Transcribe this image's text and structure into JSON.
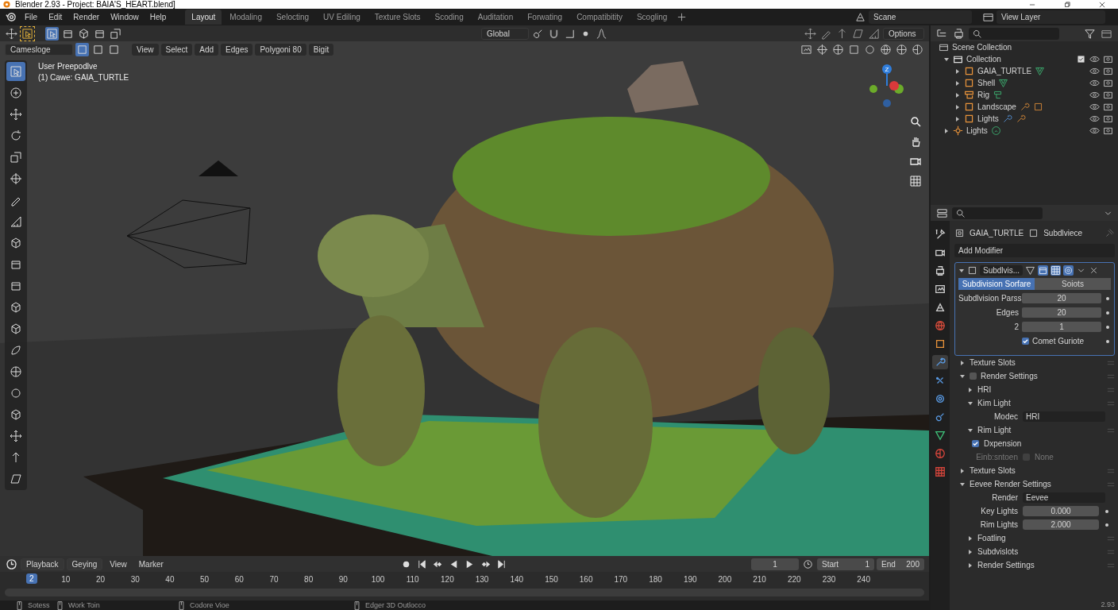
{
  "window": {
    "title": "Blender 2.93 - Project: BAIA'S_HEART.blend]"
  },
  "menu": [
    "File",
    "Edit",
    "Render",
    "Window",
    "Help"
  ],
  "workspaces": [
    {
      "label": "Layout",
      "selected": true
    },
    {
      "label": "Modaling",
      "selected": false
    },
    {
      "label": "Selocting",
      "selected": false
    },
    {
      "label": "UV Ediling",
      "selected": false
    },
    {
      "label": "Texture Slots",
      "selected": false
    },
    {
      "label": "Scoding",
      "selected": false
    },
    {
      "label": "Auditation",
      "selected": false
    },
    {
      "label": "Forwating",
      "selected": false
    },
    {
      "label": "Compatibitity",
      "selected": false
    },
    {
      "label": "Scogling",
      "selected": false
    }
  ],
  "scene": "Scane",
  "view_layer": "View Layer",
  "viewport": {
    "transform_orientation": "Global",
    "options": "Options",
    "mode": "Camesloge",
    "select_modes": [
      {
        "selected": true
      },
      {
        "selected": false
      },
      {
        "selected": false
      }
    ],
    "header_menus": [
      "View",
      "Select",
      "Add",
      "Edges",
      "Polygoni 80",
      "Bigit"
    ],
    "overlay_text": [
      "User Preepodlve",
      "(1) Cawe: GAIA_TURTLE"
    ],
    "gizmo_label": "Z",
    "tools": [
      {
        "kind": "select",
        "selected": true
      },
      {
        "kind": "cursor",
        "selected": false
      },
      {
        "kind": "move",
        "selected": false
      },
      {
        "kind": "rotate",
        "selected": false
      },
      {
        "kind": "scale",
        "selected": false
      },
      {
        "kind": "transform",
        "selected": false
      },
      {
        "kind": "pen",
        "selected": false
      },
      {
        "kind": "ruler",
        "selected": false
      },
      {
        "kind": "cube",
        "selected": false
      },
      {
        "kind": "box",
        "selected": false
      },
      {
        "kind": "box",
        "selected": false
      },
      {
        "kind": "cube",
        "selected": false
      },
      {
        "kind": "cube",
        "selected": false
      },
      {
        "kind": "leaf",
        "selected": false
      },
      {
        "kind": "ball",
        "selected": false
      },
      {
        "kind": "sphere",
        "selected": false
      },
      {
        "kind": "cube",
        "selected": false
      },
      {
        "kind": "move",
        "selected": false
      },
      {
        "kind": "push",
        "selected": false
      },
      {
        "kind": "shear",
        "selected": false
      }
    ]
  },
  "outliner": {
    "scene_collection": {
      "label": "Scene Collection",
      "children": [
        {
          "label": "Collection",
          "kind": "collection",
          "expanded": true,
          "children": [
            {
              "label": "GAIA_TURTLE",
              "kind": "object",
              "expanded": false,
              "data": [
                {
                  "kind": "mesh"
                }
              ]
            },
            {
              "label": "Shell",
              "kind": "object",
              "expanded": false,
              "data": [
                {
                  "kind": "mesh"
                }
              ]
            },
            {
              "label": "Rig",
              "kind": "rig",
              "expanded": false,
              "data": [
                {
                  "kind": "armature"
                }
              ]
            },
            {
              "label": "Landscape",
              "kind": "object",
              "expanded": false,
              "data": [
                {
                  "kind": "modifier"
                },
                {
                  "kind": "object"
                }
              ]
            },
            {
              "label": "Lights",
              "kind": "object",
              "expanded": false,
              "data": [
                {
                  "kind": "wrench"
                },
                {
                  "kind": "modifier"
                }
              ]
            }
          ]
        },
        {
          "label": "Lights",
          "kind": "light",
          "expanded": false,
          "data": [
            {
              "kind": "lightdata"
            }
          ]
        }
      ]
    }
  },
  "properties": {
    "tabs": [
      {
        "kind": "tool",
        "selected": false
      },
      {
        "kind": "render",
        "selected": false
      },
      {
        "kind": "output",
        "selected": false
      },
      {
        "kind": "view",
        "selected": false
      },
      {
        "kind": "scene",
        "selected": false
      },
      {
        "kind": "world",
        "selected": false
      },
      {
        "kind": "object",
        "selected": false
      },
      {
        "kind": "modifier",
        "selected": true
      },
      {
        "kind": "particles",
        "selected": false
      },
      {
        "kind": "physics",
        "selected": false
      },
      {
        "kind": "constraints",
        "selected": false
      },
      {
        "kind": "data",
        "selected": false
      },
      {
        "kind": "material",
        "selected": false
      },
      {
        "kind": "texture",
        "selected": false
      }
    ],
    "object": "GAIA_TURTLE",
    "modifier": "Subdlviece",
    "add_modifier": "Add Modifier",
    "modifier_panel": {
      "name": "Subdlvis...",
      "expanded": true,
      "tabs": [
        {
          "label": "Subdivision Sorfare",
          "selected": true
        },
        {
          "label": "Soiots",
          "selected": false
        }
      ],
      "fields": [
        {
          "label": "Subdlvision Parss",
          "value": "20"
        },
        {
          "label": "Edges",
          "value": "20"
        },
        {
          "label": "2",
          "value": "1"
        }
      ],
      "checkbox": {
        "label": "Comet Guriote",
        "checked": true
      }
    },
    "sections": [
      {
        "label": "Texture Slots",
        "expanded": false
      },
      {
        "label": "Render Settings",
        "expanded": true,
        "checkbox": {
          "checked": false
        },
        "children": [
          {
            "label": "HRI",
            "expanded": false
          },
          {
            "label": "Kim Light",
            "expanded": true,
            "rows": [
              {
                "kind": "dropdown",
                "label": "Modec",
                "value": "HRI"
              }
            ]
          },
          {
            "label": "Rim Light",
            "expanded": true,
            "rows": [
              {
                "kind": "checkbox",
                "label": "Dxpension",
                "checked": true,
                "disabled": false
              },
              {
                "kind": "checkbox",
                "caption": "Einb:sntoen",
                "label": "None",
                "checked": false,
                "disabled": true
              }
            ]
          }
        ]
      },
      {
        "label": "Texture Slots",
        "expanded": false
      },
      {
        "label": "Eevee Render Settings",
        "expanded": true,
        "rows": [
          {
            "kind": "dropdown",
            "label": "Render",
            "value": "Eevee"
          },
          {
            "kind": "number",
            "label": "Key Lights",
            "value": "0.000"
          },
          {
            "kind": "number",
            "label": "Rim Lights",
            "value": "2.000"
          }
        ],
        "children": [
          {
            "label": "Foatling",
            "expanded": false
          },
          {
            "label": "Subdvislots",
            "expanded": false
          },
          {
            "label": "Render Settings",
            "expanded": false
          }
        ]
      }
    ],
    "version": "2.93"
  },
  "timeline": {
    "menus": [
      "Playback",
      "Geying",
      "View",
      "Marker"
    ],
    "current_frame": "1",
    "start_label": "Start",
    "start": "1",
    "end_label": "End",
    "end": "200",
    "playhead": "2",
    "ruler": [
      "10",
      "20",
      "30",
      "40",
      "50",
      "60",
      "70",
      "80",
      "90",
      "100",
      "110",
      "120",
      "130",
      "140",
      "150",
      "160",
      "170",
      "180",
      "190",
      "200",
      "210",
      "220",
      "230",
      "240"
    ]
  },
  "status_bar": [
    "Sotess",
    "Work Toin",
    "Codore Vioe",
    "Edger 3D Outlocco"
  ]
}
